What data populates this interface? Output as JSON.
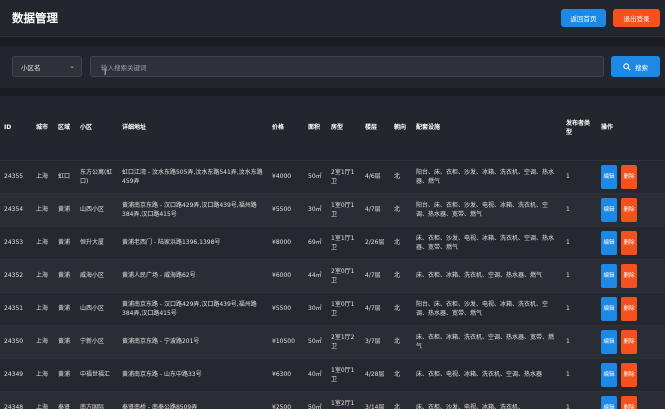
{
  "header": {
    "title": "数据管理",
    "home_label": "返回首页",
    "logout_label": "退出登录"
  },
  "search": {
    "select_value": "小区名",
    "placeholder": "输入搜索关键词",
    "button_label": "搜索",
    "search_icon": "search-icon",
    "chevron_icon": "chevron-down-icon"
  },
  "table": {
    "headers": {
      "id": "ID",
      "city": "城市",
      "district": "区域",
      "community": "小区",
      "address": "详细地址",
      "price": "价格",
      "area": "面积",
      "layout": "房型",
      "floor": "楼层",
      "orientation": "朝向",
      "facilities": "配套设施",
      "publisher": "发布者类型",
      "ops": "操作"
    },
    "edit_label": "编辑",
    "delete_label": "删除",
    "rows": [
      {
        "id": "24355",
        "city": "上海",
        "district": "虹口",
        "community": "东方公寓(虹口)",
        "address": "虹口江湾 - 汶水东路505弄,汶水东路541弄,汶水东路459弄",
        "price": "¥4000",
        "area": "50㎡",
        "layout": "2室1厅1卫",
        "floor": "4/6层",
        "orientation": "北",
        "facilities": "阳台、床、衣柜、沙发、冰箱、洗衣机、空调、热水器、燃气",
        "publisher": "1"
      },
      {
        "id": "24354",
        "city": "上海",
        "district": "黄浦",
        "community": "山西小区",
        "address": "黄浦南京东路 - 汉口路429弄,汉口路439号,福州路384弄,汉口路415号",
        "price": "¥5500",
        "area": "30㎡",
        "layout": "1室0厅1卫",
        "floor": "4/7层",
        "orientation": "北",
        "facilities": "阳台、床、衣柜、沙发、电视、冰箱、洗衣机、空调、热水器、宽带、燃气",
        "publisher": "1"
      },
      {
        "id": "24353",
        "city": "上海",
        "district": "黄浦",
        "community": "恒升大厦",
        "address": "黄浦老西门 - 陆家浜路1396,1398号",
        "price": "¥8000",
        "area": "69㎡",
        "layout": "1室1厅1卫",
        "floor": "2/26层",
        "orientation": "北",
        "facilities": "床、衣柜、沙发、电视、冰箱、洗衣机、空调、热水器、宽带、燃气",
        "publisher": "1"
      },
      {
        "id": "24352",
        "city": "上海",
        "district": "黄浦",
        "community": "威海小区",
        "address": "黄浦人民广场 - 威海路62号",
        "price": "¥6000",
        "area": "44㎡",
        "layout": "2室0厅1卫",
        "floor": "4/7层",
        "orientation": "北",
        "facilities": "床、衣柜、冰箱、洗衣机、空调、热水器、燃气",
        "publisher": "1"
      },
      {
        "id": "24351",
        "city": "上海",
        "district": "黄浦",
        "community": "山西小区",
        "address": "黄浦南京东路 - 汉口路429弄,汉口路439号,福州路384弄,汉口路415号",
        "price": "¥5500",
        "area": "30㎡",
        "layout": "1室0厅1卫",
        "floor": "4/7层",
        "orientation": "北",
        "facilities": "阳台、床、衣柜、沙发、电视、冰箱、洗衣机、空调、热水器、宽带、燃气",
        "publisher": "1"
      },
      {
        "id": "24350",
        "city": "上海",
        "district": "黄浦",
        "community": "宁新小区",
        "address": "黄浦南京东路 - 宁波路201号",
        "price": "¥10500",
        "area": "50㎡",
        "layout": "2室1厅2卫",
        "floor": "3/7层",
        "orientation": "北",
        "facilities": "床、衣柜、冰箱、洗衣机、空调、热水器、宽带、燃气",
        "publisher": "1"
      },
      {
        "id": "24349",
        "city": "上海",
        "district": "黄浦",
        "community": "中福世福汇",
        "address": "黄浦南京东路 - 山东中路33号",
        "price": "¥6300",
        "area": "40㎡",
        "layout": "1室0厅1卫",
        "floor": "4/28层",
        "orientation": "北",
        "facilities": "床、衣柜、电视、冰箱、洗衣机、空调、热水器",
        "publisher": "1"
      },
      {
        "id": "24348",
        "city": "上海",
        "district": "奉贤",
        "community": "南方国际",
        "address": "奉贤南桥 - 南奉公路8509弄",
        "price": "¥2500",
        "area": "50㎡",
        "layout": "1室2厅1卫",
        "floor": "3/14层",
        "orientation": "北",
        "facilities": "床、衣柜、沙发、电视、冰箱、洗衣机、",
        "publisher": "1"
      }
    ]
  }
}
